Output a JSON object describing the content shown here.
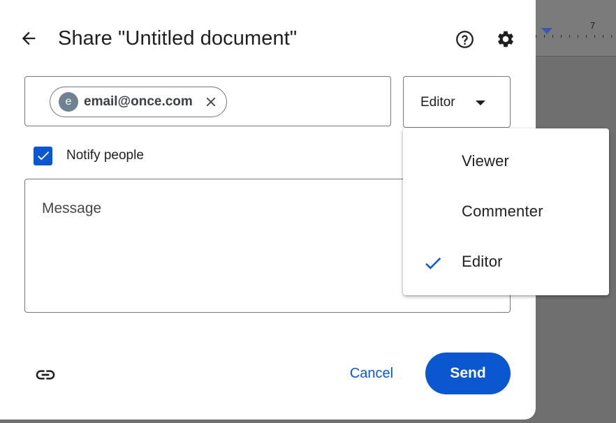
{
  "dialog": {
    "title": "Share \"Untitled document\""
  },
  "recipients": [
    {
      "initial": "e",
      "email": "email@once.com"
    }
  ],
  "role_select": {
    "selected": "Editor",
    "options": [
      "Viewer",
      "Commenter",
      "Editor"
    ]
  },
  "notify": {
    "label": "Notify people",
    "checked": true
  },
  "message": {
    "placeholder": "Message"
  },
  "actions": {
    "cancel": "Cancel",
    "send": "Send"
  },
  "background": {
    "ruler_number": "7"
  },
  "icons": {
    "back": "arrow-left-icon",
    "help": "help-circle-icon",
    "settings": "gear-icon",
    "remove": "close-icon",
    "caret": "caret-down-icon",
    "link": "link-icon",
    "check": "check-icon"
  },
  "colors": {
    "accent": "#0b57d0",
    "avatar": "#6f8291"
  }
}
